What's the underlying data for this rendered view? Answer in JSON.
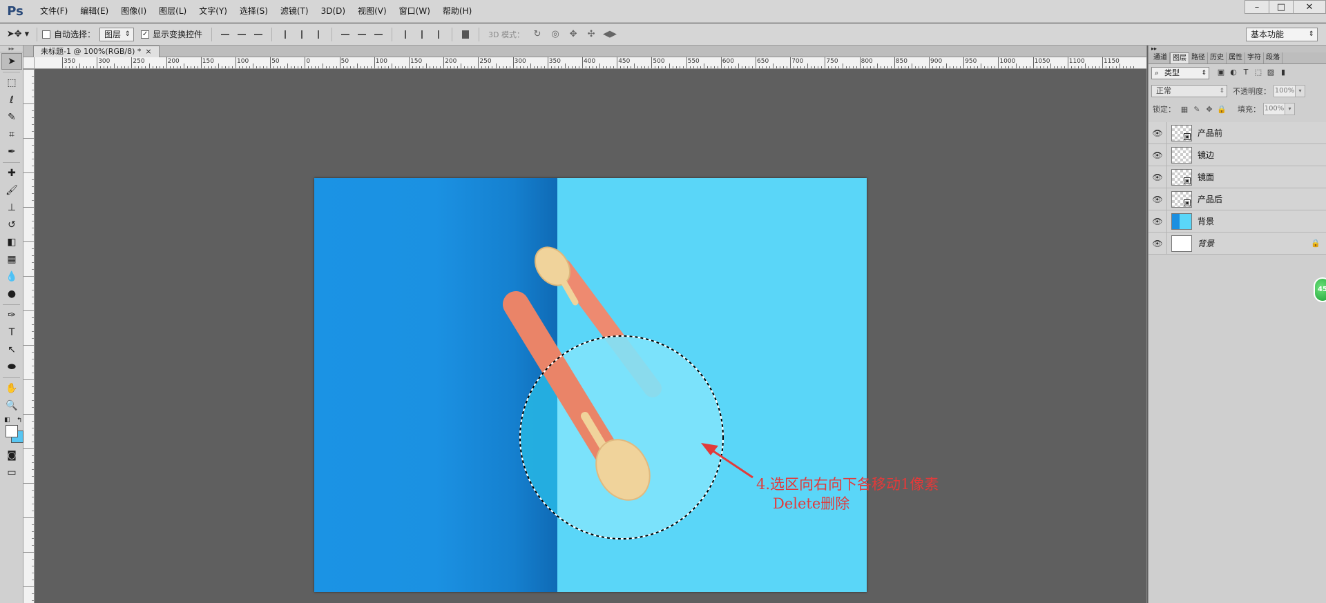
{
  "app": {
    "logo": "Ps",
    "menu": [
      "文件(F)",
      "编辑(E)",
      "图像(I)",
      "图层(L)",
      "文字(Y)",
      "选择(S)",
      "滤镜(T)",
      "3D(D)",
      "视图(V)",
      "窗口(W)",
      "帮助(H)"
    ],
    "window_controls": [
      "–",
      "□",
      "✕"
    ]
  },
  "options": {
    "auto_select_label": "自动选择：",
    "auto_select_value": "图层",
    "show_transform_label": "显示变换控件",
    "mode_3d_label": "3D 模式：",
    "workspace": "基本功能"
  },
  "document": {
    "tab_title": "未标题-1 @ 100%(RGB/8) *",
    "tab_close": "×"
  },
  "ruler": {
    "labels": [
      "350",
      "300",
      "250",
      "200",
      "150",
      "100",
      "50",
      "0",
      "50",
      "100",
      "150",
      "200",
      "250",
      "300",
      "350",
      "400",
      "450",
      "500",
      "550",
      "600",
      "650",
      "700",
      "750",
      "800",
      "850",
      "900",
      "950",
      "1000",
      "1050",
      "1100",
      "1150"
    ]
  },
  "annotation": {
    "line1": "4.选区向右向下各移动1像素",
    "line2": "Delete删除"
  },
  "panel": {
    "tabs": [
      "通道",
      "图层",
      "路径",
      "历史",
      "属性",
      "字符",
      "段落"
    ],
    "active_tab": "图层",
    "kind_label": "类型",
    "blend_mode": "正常",
    "opacity_label": "不透明度：",
    "opacity_value": "100%",
    "lock_label": "锁定：",
    "fill_label": "填充：",
    "fill_value": "100%",
    "layers": [
      {
        "name": "产品前",
        "thumb": "smart"
      },
      {
        "name": "镜边",
        "thumb": "transparent"
      },
      {
        "name": "镜面",
        "thumb": "smart"
      },
      {
        "name": "产品后",
        "thumb": "smart"
      },
      {
        "name": "背景",
        "thumb": "bg"
      },
      {
        "name": "背景",
        "thumb": "white",
        "locked": true
      }
    ],
    "scroll_badge": "45"
  },
  "colors": {
    "background_blue_light": "#5ad6f8",
    "background_blue_dark": "#1b93e4",
    "annotation_red": "#e23a3a"
  }
}
